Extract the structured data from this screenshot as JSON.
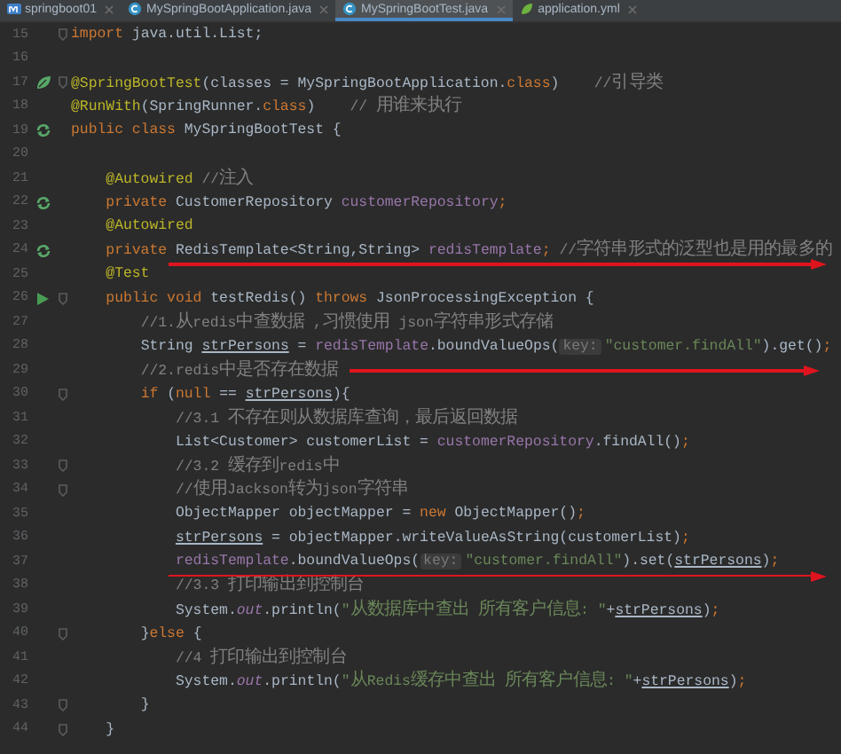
{
  "tabs": [
    {
      "label": "springboot01",
      "kind": "module",
      "selected": false
    },
    {
      "label": "MySpringBootApplication.java",
      "kind": "class",
      "selected": false
    },
    {
      "label": "MySpringBootTest.java",
      "kind": "class",
      "selected": true
    },
    {
      "label": "application.yml",
      "kind": "spring",
      "selected": false
    }
  ],
  "lines": [
    {
      "number": "15",
      "fold": true,
      "tokens": [
        {
          "kind": "k",
          "text": "import "
        },
        {
          "kind": "p",
          "text": "java.util.List;"
        }
      ]
    },
    {
      "number": "16"
    },
    {
      "number": "17",
      "gutter": {
        "kind": "leaf"
      },
      "fold": true,
      "tokens": [
        {
          "kind": "a",
          "text": "@SpringBootTest"
        },
        {
          "kind": "p",
          "text": "(classes = MySpringBootApplication."
        },
        {
          "kind": "k",
          "text": "class"
        },
        {
          "kind": "p",
          "text": ")    "
        },
        {
          "kind": "c",
          "text": "//引导类"
        }
      ]
    },
    {
      "number": "18",
      "tokens": [
        {
          "kind": "a",
          "text": "@RunWith"
        },
        {
          "kind": "p",
          "text": "(SpringRunner."
        },
        {
          "kind": "k",
          "text": "class"
        },
        {
          "kind": "p",
          "text": ")    "
        },
        {
          "kind": "c",
          "text": "// 用谁来执行"
        }
      ]
    },
    {
      "number": "19",
      "gutter": {
        "kind": "cycle"
      },
      "tokens": [
        {
          "kind": "k",
          "text": "public class "
        },
        {
          "kind": "p",
          "text": "MySpringBootTest {"
        }
      ]
    },
    {
      "number": "20"
    },
    {
      "number": "21",
      "tokens": [
        {
          "kind": "a",
          "text": "    @Autowired"
        },
        {
          "kind": "c",
          "text": " //注入"
        }
      ]
    },
    {
      "number": "22",
      "gutter": {
        "kind": "cycle"
      },
      "tokens": [
        {
          "kind": "k",
          "text": "    private "
        },
        {
          "kind": "p",
          "text": "CustomerRepository "
        },
        {
          "kind": "f",
          "text": "customerRepository"
        },
        {
          "kind": "k",
          "text": ";"
        }
      ]
    },
    {
      "number": "23",
      "tokens": [
        {
          "kind": "a",
          "text": "    @Autowired"
        }
      ]
    },
    {
      "number": "24",
      "gutter": {
        "kind": "cycle"
      },
      "arrow": {
        "kind": "under"
      },
      "tokens": [
        {
          "kind": "k",
          "text": "    private "
        },
        {
          "kind": "p",
          "text": "RedisTemplate<String,String> "
        },
        {
          "kind": "f",
          "text": "redisTemplate"
        },
        {
          "kind": "k",
          "text": ";"
        },
        {
          "kind": "c",
          "text": " //字符串形式的泛型也是用的最多的"
        }
      ]
    },
    {
      "number": "25",
      "tokens": [
        {
          "kind": "a",
          "text": "    @Test"
        }
      ]
    },
    {
      "number": "26",
      "gutter": {
        "kind": "run"
      },
      "fold": true,
      "tokens": [
        {
          "kind": "k",
          "text": "    public void "
        },
        {
          "kind": "p",
          "text": "testRedis() "
        },
        {
          "kind": "k",
          "text": "throws "
        },
        {
          "kind": "p",
          "text": "JsonProcessingException {"
        }
      ]
    },
    {
      "number": "27",
      "tokens": [
        {
          "kind": "c",
          "text": "        //1.从redis中查数据 ,习惯使用 json字符串形式存储"
        }
      ]
    },
    {
      "number": "28",
      "tokens": [
        {
          "kind": "p",
          "text": "        String "
        },
        {
          "kind": "u",
          "text": "strPersons"
        },
        {
          "kind": "p",
          "text": " = "
        },
        {
          "kind": "f",
          "text": "redisTemplate"
        },
        {
          "kind": "p",
          "text": ".boundValueOps("
        },
        {
          "kind": "h",
          "text": "key:"
        },
        {
          "kind": "s",
          "text": "\"customer.findAll\""
        },
        {
          "kind": "p",
          "text": ").get()"
        },
        {
          "kind": "k",
          "text": ";"
        }
      ]
    },
    {
      "number": "29",
      "arrow": {
        "kind": "inline"
      },
      "tokens": [
        {
          "kind": "c",
          "text": "        //2.redis中是否存在数据"
        }
      ]
    },
    {
      "number": "30",
      "fold": true,
      "tokens": [
        {
          "kind": "k",
          "text": "        if "
        },
        {
          "kind": "p",
          "text": "("
        },
        {
          "kind": "k",
          "text": "null"
        },
        {
          "kind": "p",
          "text": " == "
        },
        {
          "kind": "u",
          "text": "strPersons"
        },
        {
          "kind": "p",
          "text": "){"
        }
      ]
    },
    {
      "number": "31",
      "tokens": [
        {
          "kind": "c",
          "text": "            //3.1 不存在则从数据库查询，最后返回数据"
        }
      ]
    },
    {
      "number": "32",
      "tokens": [
        {
          "kind": "p",
          "text": "            List<Customer> customerList = "
        },
        {
          "kind": "f",
          "text": "customerRepository"
        },
        {
          "kind": "p",
          "text": ".findAll()"
        },
        {
          "kind": "k",
          "text": ";"
        }
      ]
    },
    {
      "number": "33",
      "fold": true,
      "tokens": [
        {
          "kind": "c",
          "text": "            //3.2 缓存到redis中"
        }
      ]
    },
    {
      "number": "34",
      "fold": true,
      "tokens": [
        {
          "kind": "c",
          "text": "            //使用Jackson转为json字符串"
        }
      ]
    },
    {
      "number": "35",
      "tokens": [
        {
          "kind": "p",
          "text": "            ObjectMapper objectMapper = "
        },
        {
          "kind": "k",
          "text": "new "
        },
        {
          "kind": "p",
          "text": "ObjectMapper()"
        },
        {
          "kind": "k",
          "text": ";"
        }
      ]
    },
    {
      "number": "36",
      "tokens": [
        {
          "kind": "u",
          "text": "            strPersons"
        },
        {
          "kind": "p",
          "text": " = objectMapper.writeValueAsString(customerList)"
        },
        {
          "kind": "k",
          "text": ";"
        }
      ]
    },
    {
      "number": "37",
      "arrow": {
        "kind": "under"
      },
      "tokens": [
        {
          "kind": "f",
          "text": "            redisTemplate"
        },
        {
          "kind": "p",
          "text": ".boundValueOps("
        },
        {
          "kind": "h",
          "text": "key:"
        },
        {
          "kind": "s",
          "text": "\"customer.findAll\""
        },
        {
          "kind": "p",
          "text": ").set("
        },
        {
          "kind": "u",
          "text": "strPersons"
        },
        {
          "kind": "p",
          "text": ")"
        },
        {
          "kind": "k",
          "text": ";"
        }
      ]
    },
    {
      "number": "38",
      "tokens": [
        {
          "kind": "c",
          "text": "            //3.3 打印输出到控制台"
        }
      ]
    },
    {
      "number": "39",
      "tokens": [
        {
          "kind": "p",
          "text": "            System."
        },
        {
          "kind": "o",
          "text": "out"
        },
        {
          "kind": "p",
          "text": ".println("
        },
        {
          "kind": "s",
          "text": "\"从数据库中查出 所有客户信息: \""
        },
        {
          "kind": "p",
          "text": "+"
        },
        {
          "kind": "u",
          "text": "strPersons"
        },
        {
          "kind": "p",
          "text": ")"
        },
        {
          "kind": "k",
          "text": ";"
        }
      ]
    },
    {
      "number": "40",
      "fold": true,
      "tokens": [
        {
          "kind": "p",
          "text": "        }"
        },
        {
          "kind": "k",
          "text": "else "
        },
        {
          "kind": "p",
          "text": "{"
        }
      ]
    },
    {
      "number": "41",
      "tokens": [
        {
          "kind": "c",
          "text": "            //4 打印输出到控制台"
        }
      ]
    },
    {
      "number": "42",
      "tokens": [
        {
          "kind": "p",
          "text": "            System."
        },
        {
          "kind": "o",
          "text": "out"
        },
        {
          "kind": "p",
          "text": ".println("
        },
        {
          "kind": "s",
          "text": "\"从Redis缓存中查出 所有客户信息: \""
        },
        {
          "kind": "p",
          "text": "+"
        },
        {
          "kind": "u",
          "text": "strPersons"
        },
        {
          "kind": "p",
          "text": ")"
        },
        {
          "kind": "k",
          "text": ";"
        }
      ]
    },
    {
      "number": "43",
      "fold": true,
      "tokens": [
        {
          "kind": "p",
          "text": "        }"
        }
      ]
    },
    {
      "number": "44",
      "fold": true,
      "tokens": [
        {
          "kind": "p",
          "text": "    }"
        }
      ]
    }
  ]
}
